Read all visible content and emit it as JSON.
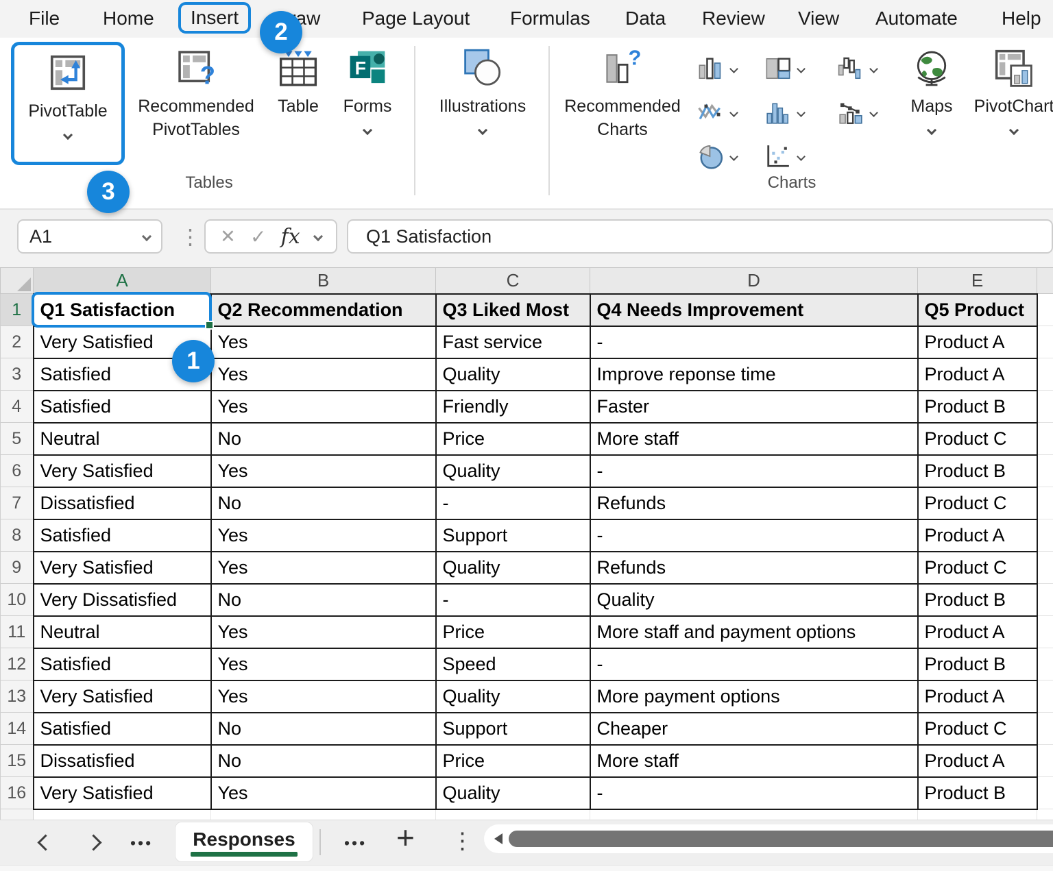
{
  "menu": {
    "items": [
      "File",
      "Home",
      "Insert",
      "Draw",
      "Page Layout",
      "Formulas",
      "Data",
      "Review",
      "View",
      "Automate",
      "Help"
    ],
    "active": "Insert"
  },
  "ribbon": {
    "pivottable": "PivotTable",
    "rec_pivot_line1": "Recommended",
    "rec_pivot_line2": "PivotTables",
    "table": "Table",
    "forms": "Forms",
    "illustrations": "Illustrations",
    "rec_charts_line1": "Recommended",
    "rec_charts_line2": "Charts",
    "maps": "Maps",
    "pivotchart": "PivotChart",
    "tables_group_label": "Tables",
    "charts_group_label": "Charts"
  },
  "formula_bar": {
    "name_box": "A1",
    "cancel_icon": "✕",
    "enter_icon": "✓",
    "fx_label": "fx",
    "value": "Q1 Satisfaction"
  },
  "grid": {
    "column_letters": [
      "A",
      "B",
      "C",
      "D",
      "E"
    ],
    "selected_column": "A",
    "selected_cell": "A1",
    "header_row": [
      "Q1 Satisfaction",
      "Q2 Recommendation",
      "Q3 Liked Most",
      "Q4 Needs Improvement",
      "Q5 Product"
    ],
    "data_rows": [
      [
        "Very Satisfied",
        "Yes",
        "Fast service",
        "-",
        "Product A"
      ],
      [
        "Satisfied",
        "Yes",
        "Quality",
        "Improve reponse time",
        "Product A"
      ],
      [
        "Satisfied",
        "Yes",
        "Friendly",
        "Faster",
        "Product B"
      ],
      [
        "Neutral",
        "No",
        "Price",
        "More staff",
        "Product C"
      ],
      [
        "Very Satisfied",
        "Yes",
        "Quality",
        "-",
        "Product B"
      ],
      [
        "Dissatisfied",
        "No",
        "-",
        "Refunds",
        "Product C"
      ],
      [
        "Satisfied",
        "Yes",
        "Support",
        "-",
        "Product A"
      ],
      [
        "Very Satisfied",
        "Yes",
        "Quality",
        "Refunds",
        "Product C"
      ],
      [
        "Very Dissatisfied",
        "No",
        "-",
        "Quality",
        "Product B"
      ],
      [
        "Neutral",
        "Yes",
        "Price",
        "More staff and payment options",
        "Product A"
      ],
      [
        "Satisfied",
        "Yes",
        "Speed",
        "-",
        "Product B"
      ],
      [
        "Very Satisfied",
        "Yes",
        "Quality",
        "More payment options",
        "Product A"
      ],
      [
        "Satisfied",
        "No",
        "Support",
        "Cheaper",
        "Product C"
      ],
      [
        "Dissatisfied",
        "No",
        "Price",
        "More staff",
        "Product A"
      ],
      [
        "Very Satisfied",
        "Yes",
        "Quality",
        "-",
        "Product B"
      ]
    ]
  },
  "sheet_bar": {
    "active_tab": "Responses",
    "overflow_icon": "•••",
    "add_icon": "+",
    "menu_icon": "⋮"
  },
  "annotations": {
    "badge_1": "1",
    "badge_2": "2",
    "badge_3": "3"
  },
  "colors": {
    "annotation_blue": "#1786db",
    "excel_green": "#1e7145"
  }
}
